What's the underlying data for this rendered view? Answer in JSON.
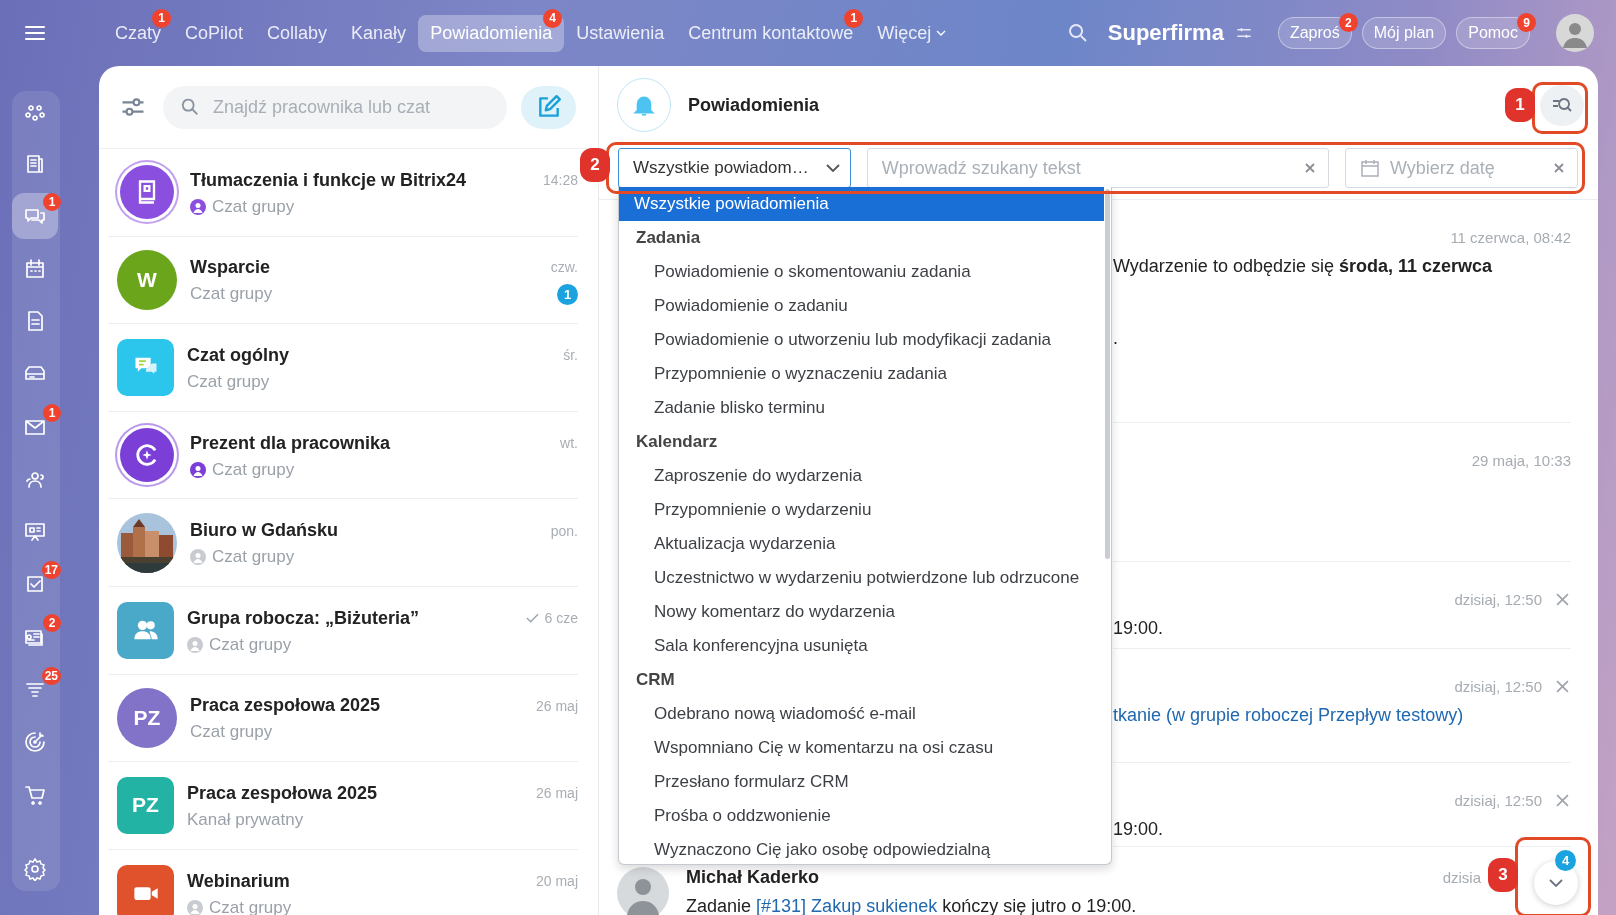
{
  "nav": {
    "tabs": [
      {
        "label": "Czaty",
        "selected": false,
        "badge": "1"
      },
      {
        "label": "CoPilot",
        "selected": false
      },
      {
        "label": "Collaby",
        "selected": false
      },
      {
        "label": "Kanały",
        "selected": false
      },
      {
        "label": "Powiadomienia",
        "selected": true,
        "badge": "4"
      },
      {
        "label": "Ustawienia",
        "selected": false
      },
      {
        "label": "Centrum kontaktowe",
        "selected": false,
        "badge": "1"
      }
    ],
    "more": "Więcej",
    "company": "Superfirma",
    "buttons": [
      {
        "label": "Zaproś",
        "badge": "2"
      },
      {
        "label": "Mój plan"
      },
      {
        "label": "Pomoc",
        "badge": "9"
      }
    ]
  },
  "rail": [
    {
      "selected": false
    },
    {
      "selected": false
    },
    {
      "selected": true,
      "badge": "1"
    },
    {
      "selected": false
    },
    {
      "selected": false
    },
    {
      "selected": false
    },
    {
      "selected": false,
      "badge": "1"
    },
    {
      "selected": false
    },
    {
      "selected": false
    },
    {
      "selected": false,
      "badge": "17"
    },
    {
      "selected": false,
      "badge": "2"
    },
    {
      "selected": false,
      "badge": "25"
    },
    {
      "selected": false
    },
    {
      "selected": false
    }
  ],
  "chat_list": {
    "search": {
      "placeholder": "Znajdź pracownika lub czat"
    },
    "chats": [
      {
        "title": "Tłumaczenia i funkcje w Bitrix24",
        "time": "14:28",
        "subtitle": "Czat grupy",
        "avatar": {
          "kind": "book-ring",
          "color": "#8b4fe0"
        },
        "sender": true,
        "read": false
      },
      {
        "title": "Wsparcie",
        "time": "czw.",
        "subtitle": "Czat grupy",
        "avatar": {
          "kind": "letter-circle",
          "text": "W",
          "color": "#6aa51c"
        },
        "sender": false,
        "read": false,
        "unread": "1"
      },
      {
        "title": "Czat ogólny",
        "time": "śr.",
        "subtitle": "Czat grupy",
        "avatar": {
          "kind": "chat-square",
          "color": "#2cc6ec"
        },
        "sender": false,
        "read": false
      },
      {
        "title": "Prezent dla pracownika",
        "time": "wt.",
        "subtitle": "Czat grupy",
        "avatar": {
          "kind": "sparkle-ring",
          "color": "#7b3fd8"
        },
        "sender": true,
        "read": false
      },
      {
        "title": "Biuro w Gdańsku",
        "time": "pon.",
        "subtitle": "Czat grupy",
        "sender": true,
        "read": false
      },
      {
        "title": "Grupa robocza: „Biżuteria”",
        "time": "6 cze",
        "subtitle": "Czat grupy",
        "avatar": {
          "kind": "people-square",
          "color": "#4aa8c8"
        },
        "sender": true,
        "read": true
      },
      {
        "title": "Praca zespołowa 2025",
        "time": "26 maj",
        "subtitle": "Czat grupy",
        "avatar": {
          "kind": "letter-circle",
          "text": "PZ",
          "color": "#8272c8"
        },
        "sender": false,
        "read": false
      },
      {
        "title": "Praca zespołowa 2025",
        "time": "26 maj",
        "subtitle": "Kanał prywatny",
        "avatar": {
          "kind": "letter-square",
          "text": "PZ",
          "color": "#22b3a4"
        },
        "sender": false,
        "read": false
      },
      {
        "title": "Webinarium",
        "time": "20 maj",
        "subtitle": "Czat grupy",
        "avatar": {
          "kind": "camera-square",
          "color": "#e0522c"
        },
        "sender": true,
        "read": false
      }
    ]
  },
  "notifications": {
    "title": "Powiadomienia",
    "filter": {
      "value": "Wszystkie powiadom…",
      "expanded": true
    },
    "search": {
      "placeholder": "Wprowadź szukany tekst"
    },
    "date": {
      "placeholder": "Wybierz datę"
    },
    "dropdown": {
      "options": [
        {
          "label": "Wszystkie powiadomienia",
          "selected": true
        }
      ],
      "groups": [
        {
          "label": "Zadania",
          "options": [
            {
              "label": "Powiadomienie o skomentowaniu zadania",
              "selected": false
            },
            {
              "label": "Powiadomienie o zadaniu",
              "selected": false
            },
            {
              "label": "Powiadomienie o utworzeniu lub modyfikacji zadania",
              "selected": false
            },
            {
              "label": "Przypomnienie o wyznaczeniu zadania",
              "selected": false
            },
            {
              "label": "Zadanie blisko terminu",
              "selected": false
            }
          ]
        },
        {
          "label": "Kalendarz",
          "options": [
            {
              "label": "Zaproszenie do wydarzenia",
              "selected": false
            },
            {
              "label": "Przypomnienie o wydarzeniu",
              "selected": false
            },
            {
              "label": "Aktualizacja wydarzenia",
              "selected": false
            },
            {
              "label": "Uczestnictwo w wydarzeniu potwierdzone lub odrzucone",
              "selected": false
            },
            {
              "label": "Nowy komentarz do wydarzenia",
              "selected": false
            },
            {
              "label": "Sala konferencyjna usunięta",
              "selected": false
            }
          ]
        },
        {
          "label": "CRM",
          "options": [
            {
              "label": "Odebrano nową wiadomość e-mail",
              "selected": false
            },
            {
              "label": "Wspomniano Cię w komentarzu na osi czasu",
              "selected": false
            },
            {
              "label": "Przesłano formularz CRM",
              "selected": false
            },
            {
              "label": "Prośba o oddzwonienie",
              "selected": false
            },
            {
              "label": "Wyznaczono Cię jako osobę odpowiedzialną",
              "selected": false
            }
          ]
        }
      ]
    },
    "messages": [
      {
        "kind": "partial",
        "time": "11 czerwca, 08:42",
        "closable": false,
        "lines": [
          [
            {
              "text": "Wydarzenie to odbędzie się **środa, 11 czerwca**",
              "link": false
            }
          ],
          [
            {
              "text": ".",
              "link": false
            }
          ]
        ]
      },
      {
        "kind": "partial",
        "time": "29 maja, 10:33",
        "closable": false
      },
      {
        "kind": "partial",
        "time": "dzisiaj, 12:50",
        "closable": true,
        "lines": [
          [
            {
              "text": "19:00.",
              "link": false
            }
          ]
        ]
      },
      {
        "kind": "partial",
        "time": "dzisiaj, 12:50",
        "closable": true,
        "lines": [
          [
            {
              "text": "tkanie (w grupie roboczej Przepływ testowy)",
              "link": true
            }
          ]
        ]
      },
      {
        "kind": "partial",
        "time": "dzisiaj, 12:50",
        "closable": true,
        "lines": [
          [
            {
              "text": "19:00.",
              "link": false
            }
          ]
        ]
      },
      {
        "kind": "full",
        "author": "Michał Kaderko",
        "time": "dzisia",
        "closable": false,
        "lines": [
          [
            {
              "text": "Zadanie",
              "link": false
            },
            {
              "text": "[#131] Zakup sukienek",
              "link": true
            },
            {
              "text": "kończy się jutro o 19:00.",
              "link": false
            }
          ]
        ]
      }
    ],
    "scroll_badge": "4"
  },
  "callouts": [
    {
      "number": "1"
    },
    {
      "number": "2"
    },
    {
      "number": "3"
    }
  ]
}
